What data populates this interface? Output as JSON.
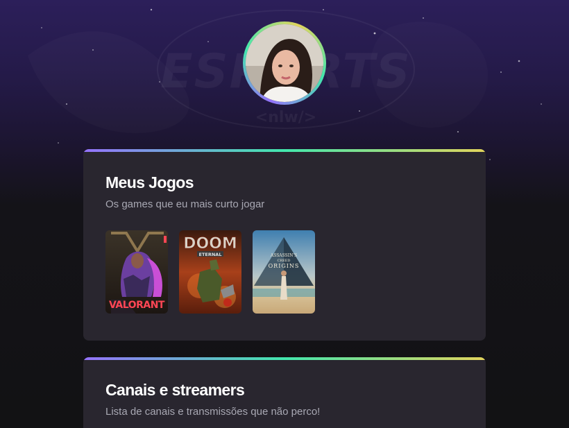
{
  "profile": {
    "avatar_icon": "profile-photo"
  },
  "background": {
    "logo_text": "ESPORTS",
    "logo_subtext": "<nlw/>"
  },
  "sections": [
    {
      "title": "Meus Jogos",
      "subtitle": "Os games que eu mais curto jogar",
      "games": [
        {
          "name": "VALORANT",
          "cover_icon": "valorant-cover"
        },
        {
          "name": "DOOM ETERNAL",
          "cover_icon": "doom-eternal-cover"
        },
        {
          "name": "ASSASSIN'S CREED ORIGINS",
          "cover_icon": "assassins-creed-origins-cover"
        }
      ]
    },
    {
      "title": "Canais e streamers",
      "subtitle": "Lista de canais e transmissões que não perco!"
    }
  ],
  "colors": {
    "gradient_start": "#9572fc",
    "gradient_mid": "#43e7ad",
    "gradient_end": "#e2d45c",
    "card_bg": "#29262f",
    "text_primary": "#ffffff",
    "text_secondary": "#a8a8b3"
  }
}
